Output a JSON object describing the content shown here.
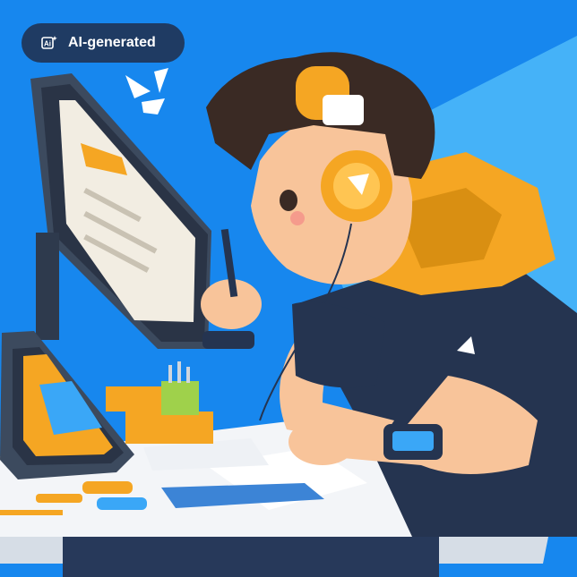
{
  "badge": {
    "label": "AI-generated",
    "icon": "ai-sparkle-icon"
  },
  "colors": {
    "background": "#1a8df0",
    "background_light": "#3aa7f7",
    "hoodie": "#f5a623",
    "shirt": "#253450",
    "skin": "#f8c49a",
    "hair": "#3a2a24",
    "headphone": "#f5a623",
    "desk": "#f3f5f8"
  }
}
